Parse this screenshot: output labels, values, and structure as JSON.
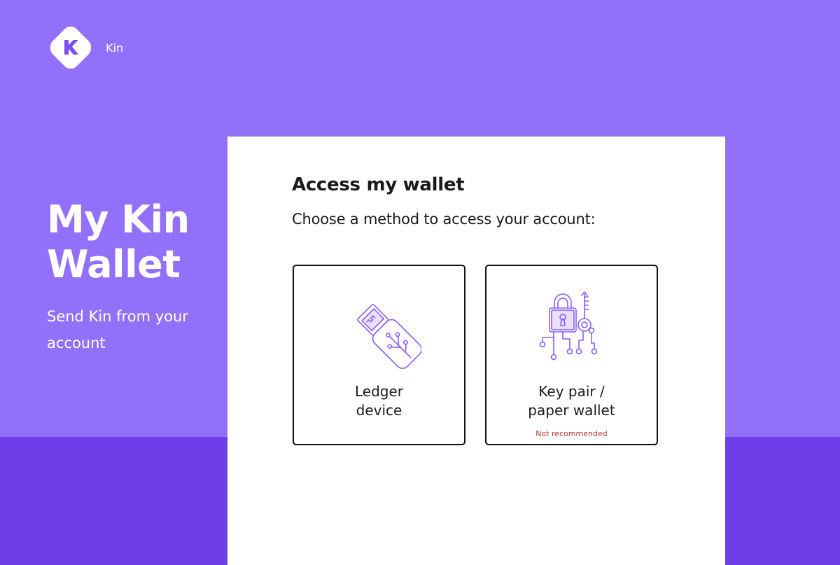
{
  "brand": {
    "name": "Kin",
    "logo_letter": "K"
  },
  "hero": {
    "title": "My Kin Wallet",
    "subtitle": "Send Kin from your account"
  },
  "card": {
    "title": "Access my wallet",
    "subtitle": "Choose a method to access your account:",
    "options": [
      {
        "label": "Ledger\ndevice",
        "icon": "usb-stick-icon",
        "note": ""
      },
      {
        "label": "Key pair /\npaper wallet",
        "icon": "padlock-key-icon",
        "note": "Not recommended"
      }
    ]
  },
  "colors": {
    "background": "#9370fa",
    "bottom_band": "#6e3fe8",
    "card": "#ffffff",
    "icon_stroke": "#8a5cf5",
    "warning": "#b1392f"
  }
}
